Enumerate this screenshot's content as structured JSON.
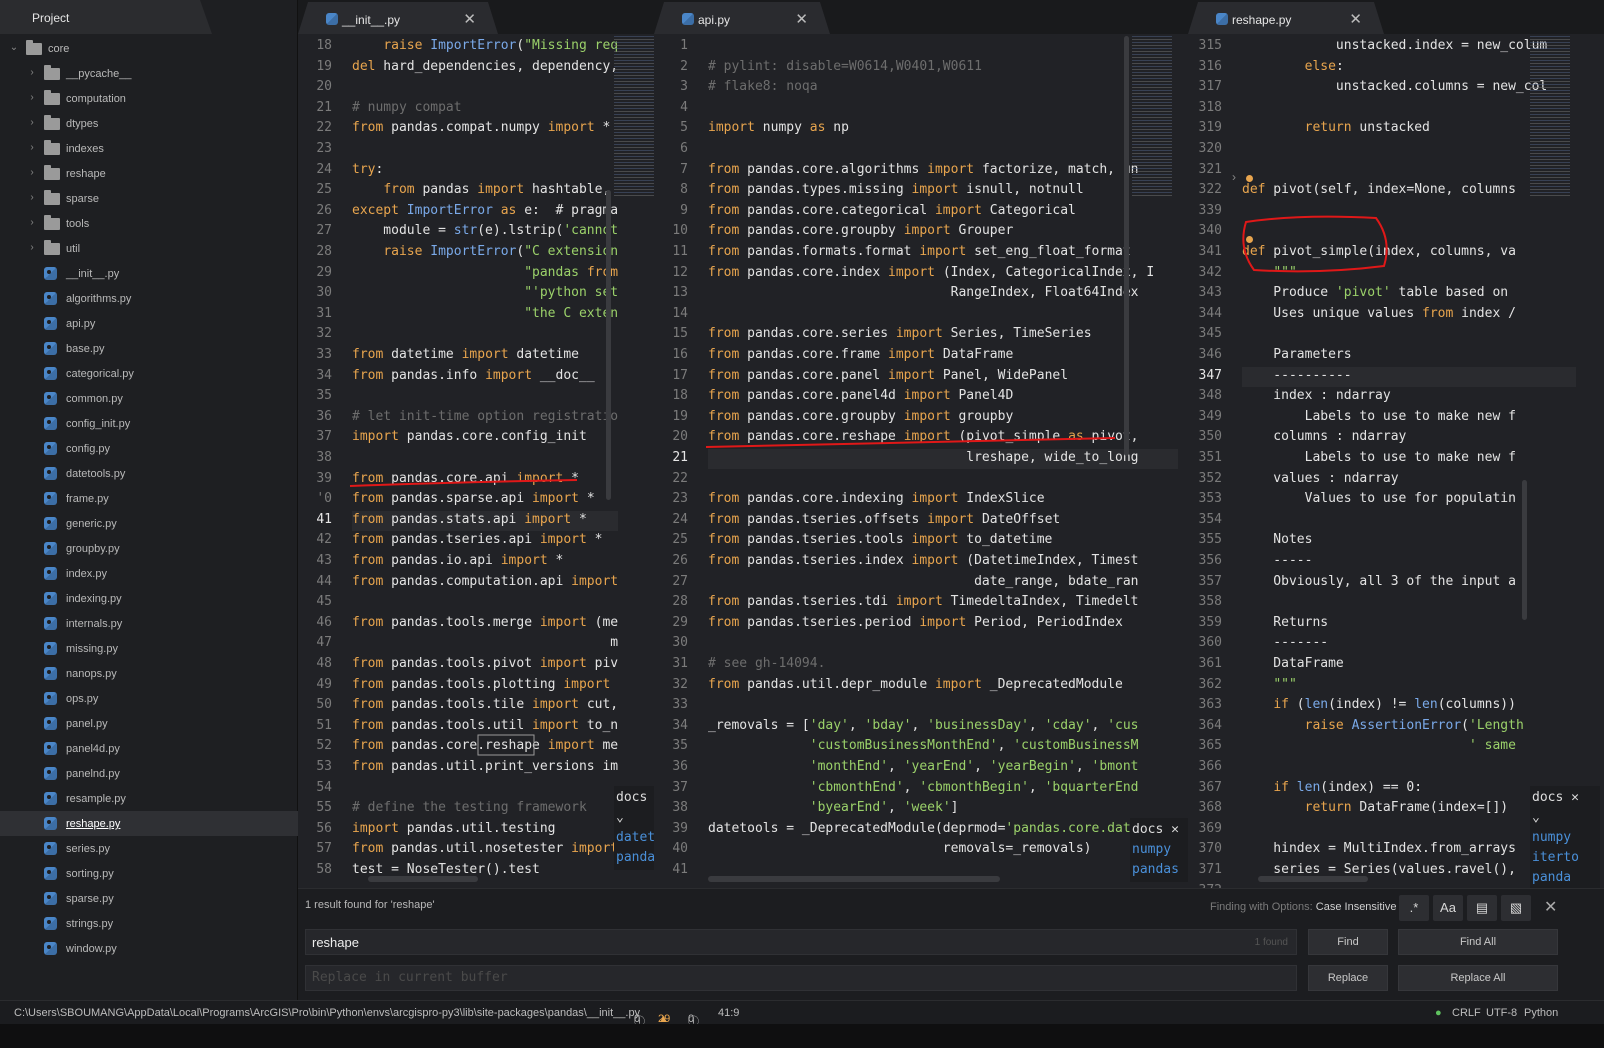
{
  "sidebar": {
    "title": "Project",
    "tree": [
      {
        "label": "core",
        "type": "folder",
        "depth": 0,
        "open": true
      },
      {
        "label": "__pycache__",
        "type": "folder",
        "depth": 1
      },
      {
        "label": "computation",
        "type": "folder",
        "depth": 1
      },
      {
        "label": "dtypes",
        "type": "folder",
        "depth": 1
      },
      {
        "label": "indexes",
        "type": "folder",
        "depth": 1
      },
      {
        "label": "reshape",
        "type": "folder",
        "depth": 1
      },
      {
        "label": "sparse",
        "type": "folder",
        "depth": 1
      },
      {
        "label": "tools",
        "type": "folder",
        "depth": 1
      },
      {
        "label": "util",
        "type": "folder",
        "depth": 1
      },
      {
        "label": "__init__.py",
        "type": "file",
        "depth": 1
      },
      {
        "label": "algorithms.py",
        "type": "file",
        "depth": 1
      },
      {
        "label": "api.py",
        "type": "file",
        "depth": 1
      },
      {
        "label": "base.py",
        "type": "file",
        "depth": 1
      },
      {
        "label": "categorical.py",
        "type": "file",
        "depth": 1
      },
      {
        "label": "common.py",
        "type": "file",
        "depth": 1
      },
      {
        "label": "config_init.py",
        "type": "file",
        "depth": 1
      },
      {
        "label": "config.py",
        "type": "file",
        "depth": 1
      },
      {
        "label": "datetools.py",
        "type": "file",
        "depth": 1
      },
      {
        "label": "frame.py",
        "type": "file",
        "depth": 1
      },
      {
        "label": "generic.py",
        "type": "file",
        "depth": 1
      },
      {
        "label": "groupby.py",
        "type": "file",
        "depth": 1
      },
      {
        "label": "index.py",
        "type": "file",
        "depth": 1
      },
      {
        "label": "indexing.py",
        "type": "file",
        "depth": 1
      },
      {
        "label": "internals.py",
        "type": "file",
        "depth": 1
      },
      {
        "label": "missing.py",
        "type": "file",
        "depth": 1
      },
      {
        "label": "nanops.py",
        "type": "file",
        "depth": 1
      },
      {
        "label": "ops.py",
        "type": "file",
        "depth": 1
      },
      {
        "label": "panel.py",
        "type": "file",
        "depth": 1
      },
      {
        "label": "panel4d.py",
        "type": "file",
        "depth": 1
      },
      {
        "label": "panelnd.py",
        "type": "file",
        "depth": 1
      },
      {
        "label": "resample.py",
        "type": "file",
        "depth": 1
      },
      {
        "label": "reshape.py",
        "type": "file",
        "depth": 1,
        "selected": true
      },
      {
        "label": "series.py",
        "type": "file",
        "depth": 1
      },
      {
        "label": "sorting.py",
        "type": "file",
        "depth": 1
      },
      {
        "label": "sparse.py",
        "type": "file",
        "depth": 1
      },
      {
        "label": "strings.py",
        "type": "file",
        "depth": 1
      },
      {
        "label": "window.py",
        "type": "file",
        "depth": 1
      }
    ]
  },
  "panes": [
    {
      "tab": "__init__.py",
      "cursor_line": "41",
      "lines": [
        [
          "18",
          "    raise ImportError(\"Missing req"
        ],
        [
          "19",
          "del hard_dependencies, dependency,"
        ],
        [
          "20",
          ""
        ],
        [
          "21",
          "# numpy compat"
        ],
        [
          "22",
          "from pandas.compat.numpy import *"
        ],
        [
          "23",
          ""
        ],
        [
          "24",
          "try:"
        ],
        [
          "25",
          "    from pandas import hashtable,"
        ],
        [
          "26",
          "except ImportError as e:  # pragma"
        ],
        [
          "27",
          "    module = str(e).lstrip('cannot"
        ],
        [
          "28",
          "    raise ImportError(\"C extension"
        ],
        [
          "29",
          "                      \"pandas from"
        ],
        [
          "30",
          "                      \"'python set"
        ],
        [
          "31",
          "                      \"the C exten"
        ],
        [
          "32",
          ""
        ],
        [
          "33",
          "from datetime import datetime"
        ],
        [
          "34",
          "from pandas.info import __doc__"
        ],
        [
          "35",
          ""
        ],
        [
          "36",
          "# let init-time option registratio"
        ],
        [
          "37",
          "import pandas.core.config_init"
        ],
        [
          "38",
          ""
        ],
        [
          "39",
          "from pandas.core.api import *"
        ],
        [
          "'0",
          "from pandas.sparse.api import *"
        ],
        [
          "41",
          "from pandas.stats.api import *"
        ],
        [
          "42",
          "from pandas.tseries.api import *"
        ],
        [
          "43",
          "from pandas.io.api import *"
        ],
        [
          "44",
          "from pandas.computation.api import"
        ],
        [
          "45",
          ""
        ],
        [
          "46",
          "from pandas.tools.merge import (me"
        ],
        [
          "47",
          "                                 me"
        ],
        [
          "48",
          "from pandas.tools.pivot import piv"
        ],
        [
          "49",
          "from pandas.tools.plotting import"
        ],
        [
          "50",
          "from pandas.tools.tile import cut,"
        ],
        [
          "51",
          "from pandas.tools.util import to_n"
        ],
        [
          "52",
          "from pandas.core.reshape import me"
        ],
        [
          "53",
          "from pandas.util.print_versions im"
        ],
        [
          "54",
          ""
        ],
        [
          "55",
          "# define the testing framework"
        ],
        [
          "56",
          "import pandas.util.testing"
        ],
        [
          "57",
          "from pandas.util.nosetester import"
        ],
        [
          "58",
          "test = NoseTester().test"
        ]
      ],
      "docs": {
        "title": "docs",
        "items": [
          "dateti",
          "panda"
        ]
      }
    },
    {
      "tab": "api.py",
      "cursor_line": "21",
      "lines": [
        [
          "1",
          ""
        ],
        [
          "2",
          "# pylint: disable=W0614,W0401,W0611"
        ],
        [
          "3",
          "# flake8: noqa"
        ],
        [
          "4",
          ""
        ],
        [
          "5",
          "import numpy as np"
        ],
        [
          "6",
          ""
        ],
        [
          "7",
          "from pandas.core.algorithms import factorize, match, un"
        ],
        [
          "8",
          "from pandas.types.missing import isnull, notnull"
        ],
        [
          "9",
          "from pandas.core.categorical import Categorical"
        ],
        [
          "10",
          "from pandas.core.groupby import Grouper"
        ],
        [
          "11",
          "from pandas.formats.format import set_eng_float_format"
        ],
        [
          "12",
          "from pandas.core.index import (Index, CategoricalIndex, I"
        ],
        [
          "13",
          "                               RangeIndex, Float64Index"
        ],
        [
          "14",
          ""
        ],
        [
          "15",
          "from pandas.core.series import Series, TimeSeries"
        ],
        [
          "16",
          "from pandas.core.frame import DataFrame"
        ],
        [
          "17",
          "from pandas.core.panel import Panel, WidePanel"
        ],
        [
          "18",
          "from pandas.core.panel4d import Panel4D"
        ],
        [
          "19",
          "from pandas.core.groupby import groupby"
        ],
        [
          "20",
          "from pandas.core.reshape import (pivot_simple as pivot,"
        ],
        [
          "21",
          "                                 lreshape, wide_to_long"
        ],
        [
          "22",
          ""
        ],
        [
          "23",
          "from pandas.core.indexing import IndexSlice"
        ],
        [
          "24",
          "from pandas.tseries.offsets import DateOffset"
        ],
        [
          "25",
          "from pandas.tseries.tools import to_datetime"
        ],
        [
          "26",
          "from pandas.tseries.index import (DatetimeIndex, Timest"
        ],
        [
          "27",
          "                                  date_range, bdate_ran"
        ],
        [
          "28",
          "from pandas.tseries.tdi import TimedeltaIndex, Timedelt"
        ],
        [
          "29",
          "from pandas.tseries.period import Period, PeriodIndex"
        ],
        [
          "30",
          ""
        ],
        [
          "31",
          "# see gh-14094."
        ],
        [
          "32",
          "from pandas.util.depr_module import _DeprecatedModule"
        ],
        [
          "33",
          ""
        ],
        [
          "34",
          "_removals = ['day', 'bday', 'businessDay', 'cday', 'cus"
        ],
        [
          "35",
          "             'customBusinessMonthEnd', 'customBusinessM"
        ],
        [
          "36",
          "             'monthEnd', 'yearEnd', 'yearBegin', 'bmont"
        ],
        [
          "37",
          "             'cbmonthEnd', 'cbmonthBegin', 'bquarterEnd"
        ],
        [
          "38",
          "             'byearEnd', 'week']"
        ],
        [
          "39",
          "datetools = _DeprecatedModule(deprmod='pandas.core.date"
        ],
        [
          "40",
          "                              removals=_removals)"
        ],
        [
          "41",
          ""
        ]
      ],
      "docs": {
        "title": "docs",
        "items": [
          "numpy",
          "pandas"
        ]
      }
    },
    {
      "tab": "reshape.py",
      "cursor_line": "347",
      "lines": [
        [
          "315",
          "            unstacked.index = new_colum"
        ],
        [
          "316",
          "        else:"
        ],
        [
          "317",
          "            unstacked.columns = new_col"
        ],
        [
          "318",
          ""
        ],
        [
          "319",
          "        return unstacked"
        ],
        [
          "320",
          ""
        ],
        [
          "321",
          ""
        ],
        [
          "322",
          "def pivot(self, index=None, columns"
        ],
        [
          "339",
          ""
        ],
        [
          "340",
          ""
        ],
        [
          "341",
          "def pivot_simple(index, columns, va"
        ],
        [
          "342",
          "    \"\"\""
        ],
        [
          "343",
          "    Produce 'pivot' table based on"
        ],
        [
          "344",
          "    Uses unique values from index /"
        ],
        [
          "345",
          ""
        ],
        [
          "346",
          "    Parameters"
        ],
        [
          "347",
          "    ----------"
        ],
        [
          "348",
          "    index : ndarray"
        ],
        [
          "349",
          "        Labels to use to make new f"
        ],
        [
          "350",
          "    columns : ndarray"
        ],
        [
          "351",
          "        Labels to use to make new f"
        ],
        [
          "352",
          "    values : ndarray"
        ],
        [
          "353",
          "        Values to use for populatin"
        ],
        [
          "354",
          ""
        ],
        [
          "355",
          "    Notes"
        ],
        [
          "356",
          "    -----"
        ],
        [
          "357",
          "    Obviously, all 3 of the input a"
        ],
        [
          "358",
          ""
        ],
        [
          "359",
          "    Returns"
        ],
        [
          "360",
          "    -------"
        ],
        [
          "361",
          "    DataFrame"
        ],
        [
          "362",
          "    \"\"\""
        ],
        [
          "363",
          "    if (len(index) != len(columns))"
        ],
        [
          "364",
          "        raise AssertionError('Length"
        ],
        [
          "365",
          "                             ' same"
        ],
        [
          "366",
          ""
        ],
        [
          "367",
          "    if len(index) == 0:"
        ],
        [
          "368",
          "        return DataFrame(index=[])"
        ],
        [
          "369",
          ""
        ],
        [
          "370",
          "    hindex = MultiIndex.from_arrays"
        ],
        [
          "371",
          "    series = Series(values.ravel(),"
        ],
        [
          "372",
          ""
        ]
      ],
      "docs": {
        "title": "docs",
        "items": [
          "numpy",
          "iterto",
          "panda"
        ]
      }
    }
  ],
  "find": {
    "results": "1 result found for 'reshape'",
    "options_label": "Finding with Options:",
    "options_value": "Case Insensitive",
    "find_value": "reshape",
    "found_count": "1 found",
    "replace_placeholder": "Replace in current buffer",
    "find_btn": "Find",
    "find_all_btn": "Find All",
    "replace_btn": "Replace",
    "replace_all_btn": "Replace All",
    "regex_btn": ".*",
    "case_btn": "Aa"
  },
  "status": {
    "path": "C:\\Users\\SBOUMANG\\AppData\\Local\\Programs\\ArcGIS\\Pro\\bin\\Python\\envs\\arcgispro-py3\\lib\\site-packages\\pandas\\__init__.py",
    "errors": "0",
    "warnings": "29",
    "infos": "0",
    "cursor": "41:9",
    "line_ending": "CRLF",
    "encoding": "UTF-8",
    "grammar": "Python"
  },
  "colors": {
    "keyword": "#e8a54e",
    "string": "#9bd16a",
    "comment": "#6d6d6d",
    "function": "#7aa9e8",
    "annotation": "#e01818"
  }
}
